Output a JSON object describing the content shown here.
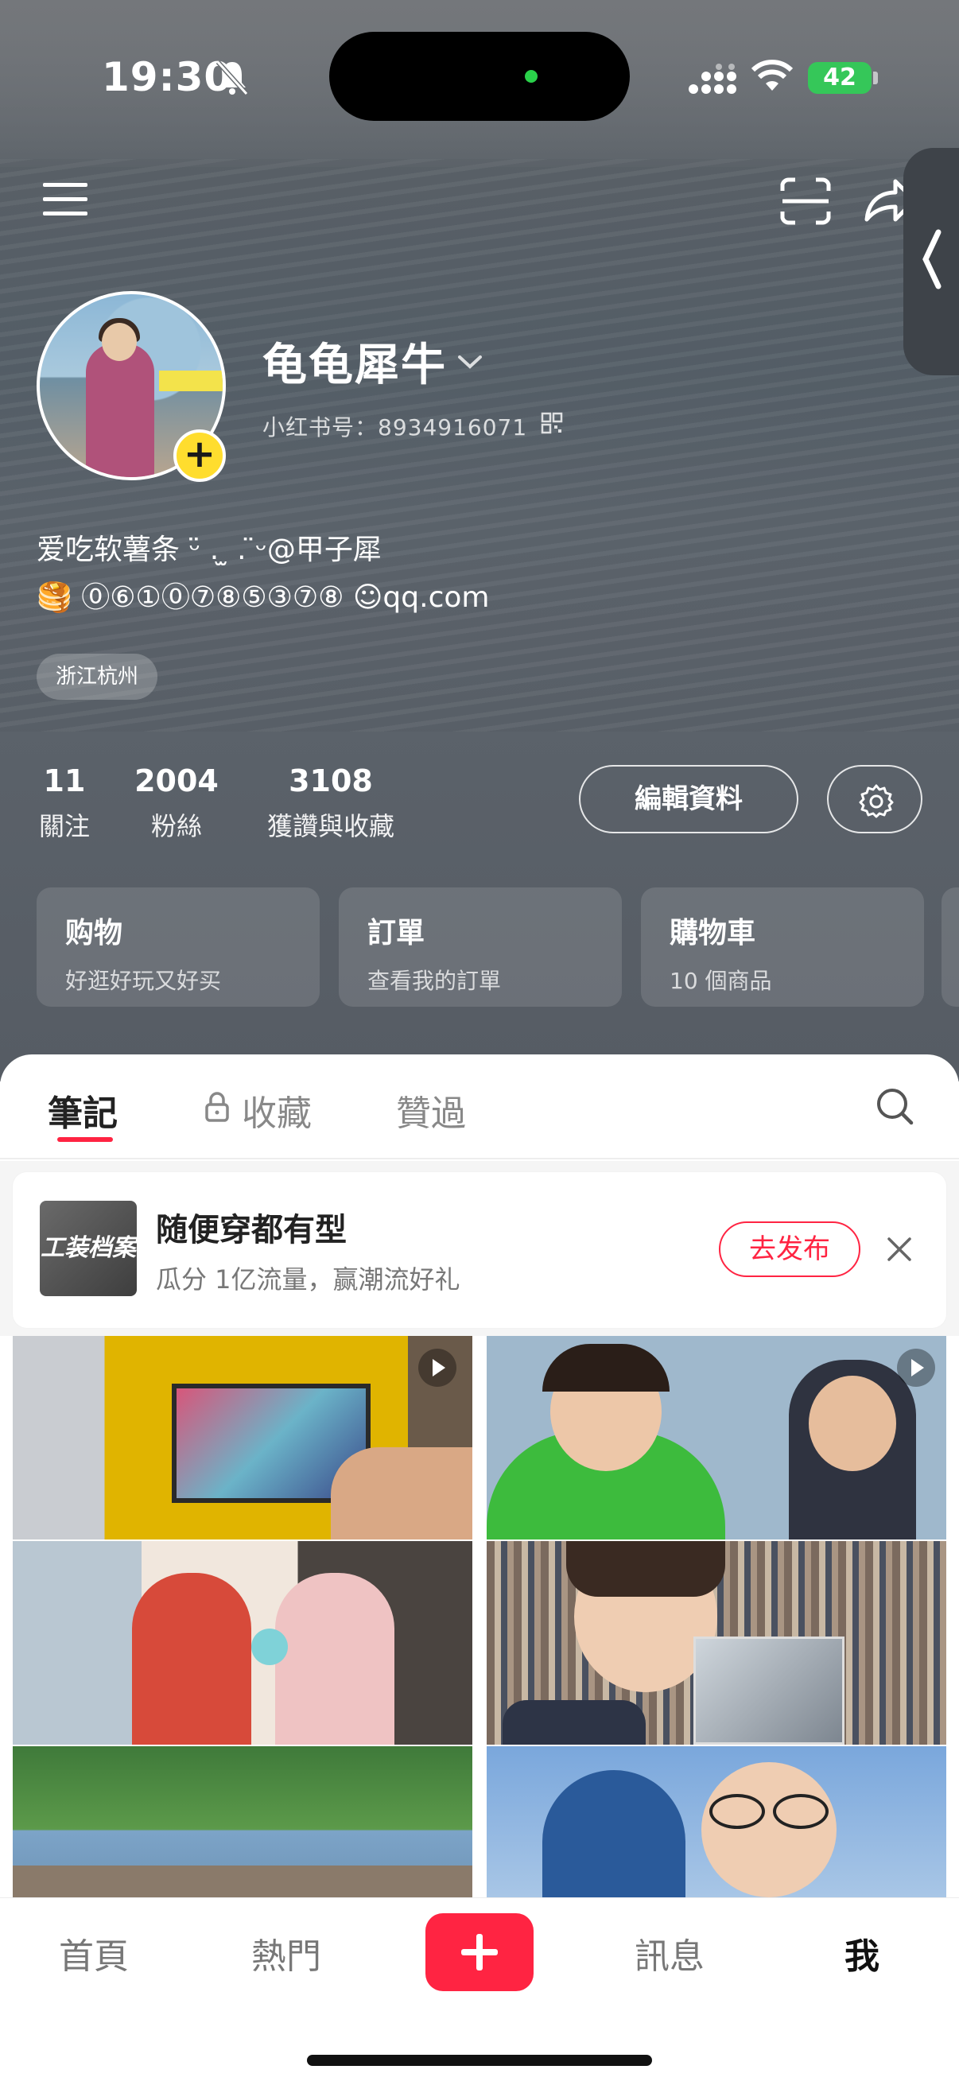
{
  "status_bar": {
    "time": "19:30",
    "battery": "42"
  },
  "profile": {
    "username": "龟龟犀牛",
    "redbook_id": "小红书号：8934916071",
    "bio_line1": "爱吃软薯条 ᵕ̈ . ̫ . ̈ᵕ@甲子犀",
    "bio_line2": "🥞 ⓪⑥①⓪⑦⑧⑤③⑦⑧ ☺qq.com",
    "location": "浙江杭州"
  },
  "stats": [
    {
      "value": "11",
      "label": "關注"
    },
    {
      "value": "2004",
      "label": "粉絲"
    },
    {
      "value": "3108",
      "label": "獲讚與收藏"
    }
  ],
  "actions": {
    "edit_profile": "編輯資料"
  },
  "cards": [
    {
      "title": "购物",
      "subtitle": "好逛好玩又好买"
    },
    {
      "title": "訂單",
      "subtitle": "查看我的訂單"
    },
    {
      "title": "購物車",
      "subtitle": "10 個商品"
    }
  ],
  "tabs": [
    {
      "label": "筆記",
      "active": true
    },
    {
      "label": "收藏",
      "locked": true
    },
    {
      "label": "贊過"
    }
  ],
  "promo": {
    "thumb_text": "工装档案",
    "title": "随便穿都有型",
    "subtitle": "瓜分 1亿流量，赢潮流好礼",
    "button": "去发布"
  },
  "bottom_nav": [
    {
      "label": "首頁"
    },
    {
      "label": "熱門"
    },
    {
      "label": "訊息"
    },
    {
      "label": "我",
      "active": true
    }
  ],
  "colors": {
    "accent": "#ff2442",
    "badge_yellow": "#ffdd2e",
    "battery_green": "#35c759"
  }
}
